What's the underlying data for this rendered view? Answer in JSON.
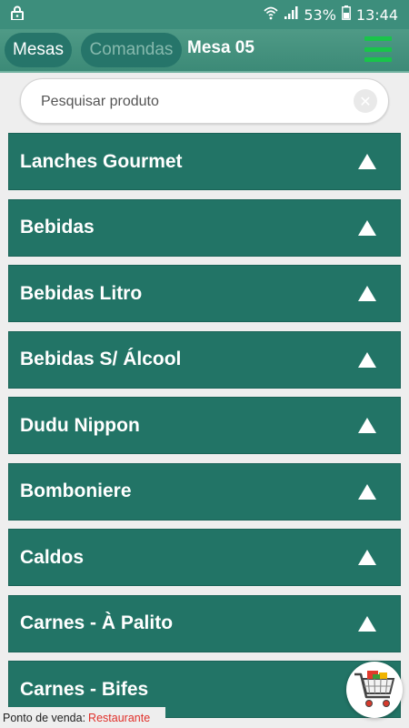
{
  "status_bar": {
    "battery_percent": "53%",
    "time": "13:44",
    "icons": [
      "lock-icon",
      "wifi-icon",
      "signal-icon",
      "battery-icon"
    ]
  },
  "toolbar": {
    "mesas_label": "Mesas",
    "comandas_label": "Comandas",
    "title": "Mesa 05",
    "menu_icon": "hamburger-menu-icon"
  },
  "search": {
    "placeholder": "Pesquisar produto",
    "value": "",
    "clear_icon": "clear-x-icon"
  },
  "categories": [
    {
      "label": "Lanches Gourmet"
    },
    {
      "label": "Bebidas"
    },
    {
      "label": "Bebidas Litro"
    },
    {
      "label": "Bebidas S/ Álcool"
    },
    {
      "label": "Dudu Nippon"
    },
    {
      "label": "Bomboniere"
    },
    {
      "label": "Caldos"
    },
    {
      "label": "Carnes - À Palito"
    },
    {
      "label": "Carnes - Bifes"
    }
  ],
  "footer": {
    "label": "Ponto de venda:",
    "value": "Restaurante"
  },
  "cart_icon": "shopping-cart-icon",
  "colors": {
    "header": "#3d8e7c",
    "category_bg": "#227466",
    "menu_icon": "#19c44a",
    "footer_value": "#e0302a"
  }
}
